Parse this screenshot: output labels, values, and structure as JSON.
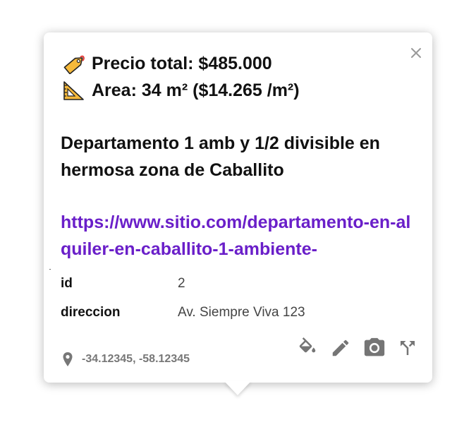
{
  "popup": {
    "price_line": "Precio total: $485.000",
    "area_line": "Area: 34 m² ($14.265 /m²)",
    "title": "Departamento 1 amb y 1/2 divisible en hermosa zona de Caballito",
    "link": "https://www.sitio.com/departamento-en-alquiler-en-caballito-1-ambiente-",
    "attributes": [
      {
        "key": "id",
        "value": "2"
      },
      {
        "key": "direccion",
        "value": "Av. Siempre Viva 123"
      }
    ],
    "coords": "-34.12345, -58.12345",
    "icons": {
      "price": "price-tag-icon",
      "area": "triangular-ruler-icon",
      "close": "close-icon",
      "location": "location-pin-icon",
      "style": "paint-bucket-icon",
      "edit": "pencil-icon",
      "snapshot": "camera-icon",
      "directions": "directions-icon"
    },
    "colors": {
      "link": "#6a1fc9",
      "icon": "#757575"
    }
  }
}
